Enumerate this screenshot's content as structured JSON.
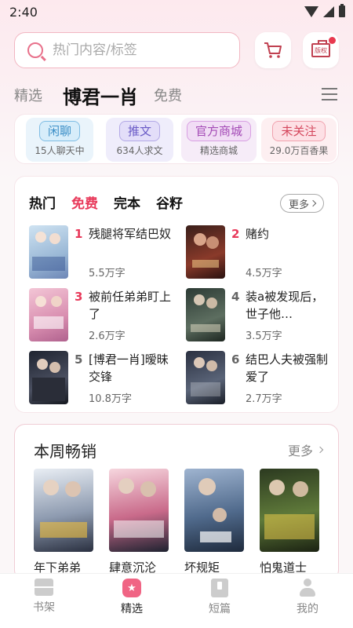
{
  "status": {
    "time": "2:40"
  },
  "search": {
    "placeholder": "热门内容/标签"
  },
  "topbar": {
    "copyright_icon_text": "版权"
  },
  "tabs": {
    "items": [
      "精选",
      "博君一肖",
      "免费"
    ]
  },
  "quick": [
    {
      "label": "闲聊",
      "sub": "15人聊天中"
    },
    {
      "label": "推文",
      "sub": "634人求文"
    },
    {
      "label": "官方商城",
      "sub": "精选商城"
    },
    {
      "label": "未关注",
      "sub": "29.0万百香果"
    }
  ],
  "rank": {
    "tabs": [
      "热门",
      "免费",
      "完本",
      "谷籽"
    ],
    "more": "更多",
    "books": [
      {
        "num": "1",
        "title": "残腿将军结巴奴",
        "count": "5.5万字"
      },
      {
        "num": "2",
        "title": "赌约",
        "count": "4.5万字"
      },
      {
        "num": "3",
        "title": "被前任弟弟盯上了",
        "count": "2.6万字"
      },
      {
        "num": "4",
        "title": "装a被发现后，世子他…",
        "count": "3.5万字"
      },
      {
        "num": "5",
        "title": "[博君一肖]暧昧交锋",
        "count": "10.8万字"
      },
      {
        "num": "6",
        "title": "结巴人夫被强制爱了",
        "count": "2.7万字"
      }
    ]
  },
  "weekly": {
    "title": "本周畅销",
    "more": "更多",
    "books": [
      {
        "name": "年下弟弟"
      },
      {
        "name": "肆意沉沦"
      },
      {
        "name": "坏规矩"
      },
      {
        "name": "怕鬼道士"
      }
    ]
  },
  "nav": [
    {
      "label": "书架",
      "icon": "bookshelf-icon"
    },
    {
      "label": "精选",
      "icon": "featured-star-icon"
    },
    {
      "label": "短篇",
      "icon": "short-story-icon"
    },
    {
      "label": "我的",
      "icon": "profile-icon"
    }
  ],
  "colors": {
    "accent": "#e8395a",
    "nav_active": "#f06484"
  }
}
